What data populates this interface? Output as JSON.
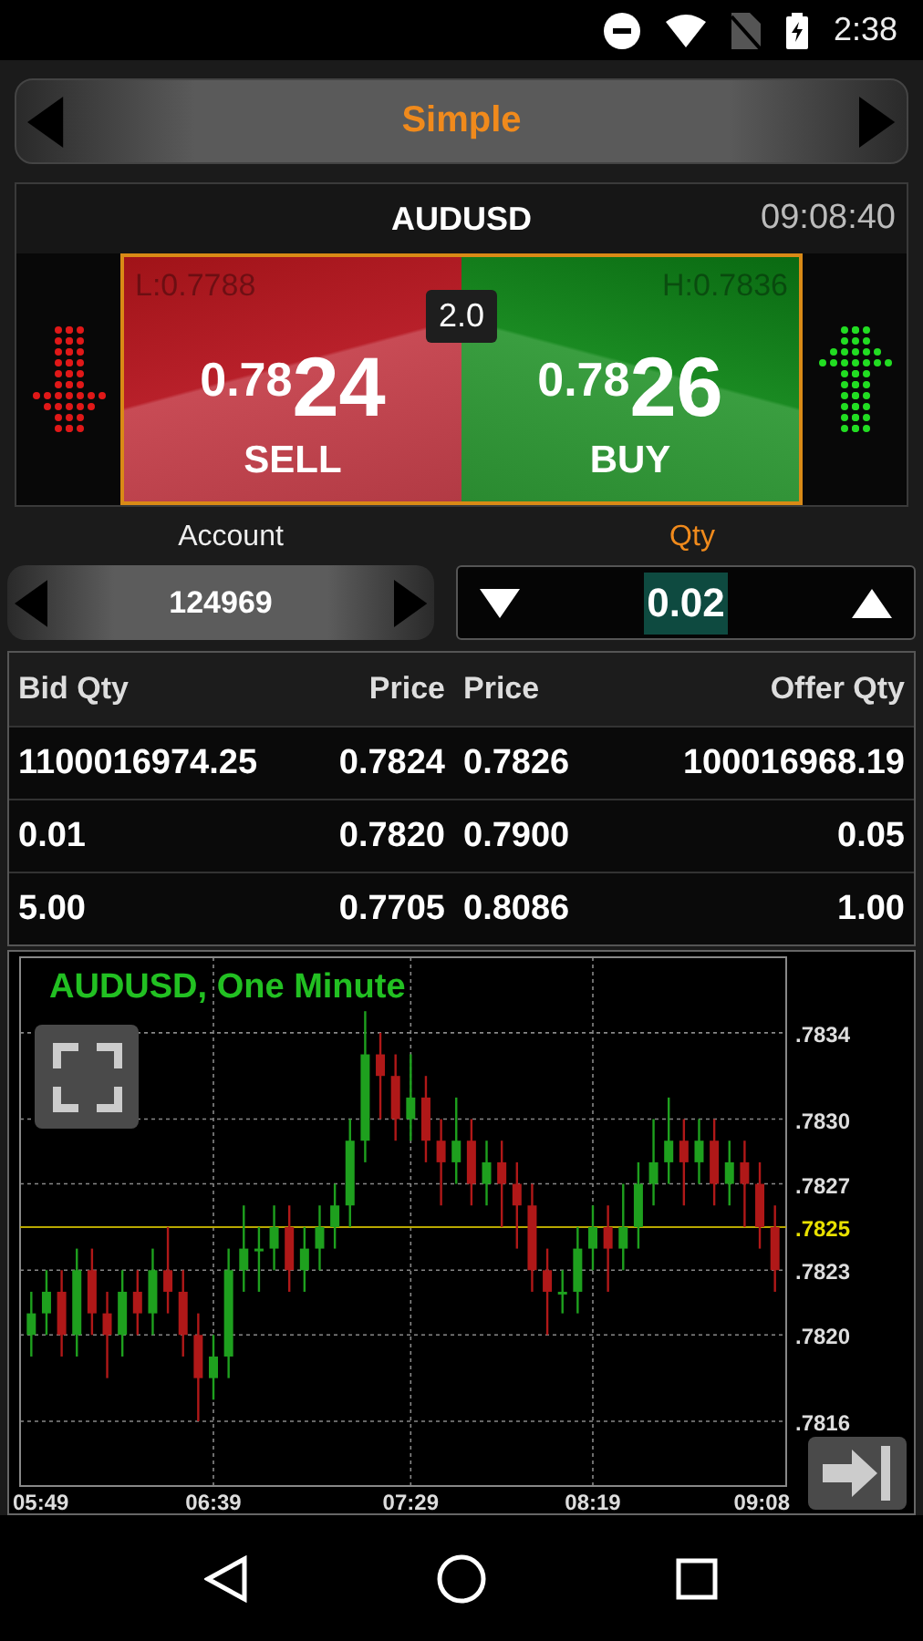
{
  "status_bar": {
    "time": "2:38"
  },
  "mode_selector": {
    "label": "Simple"
  },
  "quote": {
    "symbol": "AUDUSD",
    "time": "09:08:40",
    "low": "L:0.7788",
    "high": "H:0.7836",
    "spread": "2.0",
    "sell": {
      "price_prefix": "0.78",
      "price_big": "24",
      "label": "SELL"
    },
    "buy": {
      "price_prefix": "0.78",
      "price_big": "26",
      "label": "BUY"
    }
  },
  "account": {
    "label": "Account",
    "value": "124969"
  },
  "qty": {
    "label": "Qty",
    "value": "0.02"
  },
  "depth_table": {
    "columns": [
      "Bid Qty",
      "Price",
      "Price",
      "Offer Qty"
    ],
    "rows": [
      [
        "1100016974.25",
        "0.7824",
        "0.7826",
        "100016968.19"
      ],
      [
        "0.01",
        "0.7820",
        "0.7900",
        "0.05"
      ],
      [
        "5.00",
        "0.7705",
        "0.8086",
        "1.00"
      ]
    ]
  },
  "chart": {
    "chart_data": {
      "type": "candlestick",
      "title": "AUDUSD, One Minute",
      "categories": [
        "05:49",
        null,
        null,
        null,
        null,
        null,
        null,
        null,
        null,
        null,
        null,
        null,
        "06:39",
        null,
        null,
        null,
        null,
        null,
        null,
        null,
        null,
        null,
        null,
        null,
        null,
        "07:29",
        null,
        null,
        null,
        null,
        null,
        null,
        null,
        null,
        null,
        null,
        null,
        "08:19",
        null,
        null,
        null,
        null,
        null,
        null,
        null,
        null,
        null,
        null,
        null,
        "09:08"
      ],
      "ohlc": [
        [
          0.782,
          0.7822,
          0.7819,
          0.7821
        ],
        [
          0.7821,
          0.7823,
          0.782,
          0.7822
        ],
        [
          0.7822,
          0.7823,
          0.7819,
          0.782
        ],
        [
          0.782,
          0.7824,
          0.7819,
          0.7823
        ],
        [
          0.7823,
          0.7824,
          0.782,
          0.7821
        ],
        [
          0.7821,
          0.7822,
          0.7818,
          0.782
        ],
        [
          0.782,
          0.7823,
          0.7819,
          0.7822
        ],
        [
          0.7822,
          0.7823,
          0.782,
          0.7821
        ],
        [
          0.7821,
          0.7824,
          0.782,
          0.7823
        ],
        [
          0.7823,
          0.7825,
          0.7821,
          0.7822
        ],
        [
          0.7822,
          0.7823,
          0.7819,
          0.782
        ],
        [
          0.782,
          0.7821,
          0.7816,
          0.7818
        ],
        [
          0.7818,
          0.782,
          0.7817,
          0.7819
        ],
        [
          0.7819,
          0.7824,
          0.7818,
          0.7823
        ],
        [
          0.7823,
          0.7826,
          0.7822,
          0.7824
        ],
        [
          0.7824,
          0.7825,
          0.7822,
          0.7824
        ],
        [
          0.7824,
          0.7826,
          0.7823,
          0.7825
        ],
        [
          0.7825,
          0.7826,
          0.7822,
          0.7823
        ],
        [
          0.7823,
          0.7825,
          0.7822,
          0.7824
        ],
        [
          0.7824,
          0.7826,
          0.7823,
          0.7825
        ],
        [
          0.7825,
          0.7827,
          0.7824,
          0.7826
        ],
        [
          0.7826,
          0.783,
          0.7825,
          0.7829
        ],
        [
          0.7829,
          0.7835,
          0.7828,
          0.7833
        ],
        [
          0.7833,
          0.7834,
          0.783,
          0.7832
        ],
        [
          0.7832,
          0.7833,
          0.7829,
          0.783
        ],
        [
          0.783,
          0.7833,
          0.7829,
          0.7831
        ],
        [
          0.7831,
          0.7832,
          0.7828,
          0.7829
        ],
        [
          0.7829,
          0.783,
          0.7826,
          0.7828
        ],
        [
          0.7828,
          0.7831,
          0.7827,
          0.7829
        ],
        [
          0.7829,
          0.783,
          0.7826,
          0.7827
        ],
        [
          0.7827,
          0.7829,
          0.7826,
          0.7828
        ],
        [
          0.7828,
          0.7829,
          0.7825,
          0.7827
        ],
        [
          0.7827,
          0.7828,
          0.7824,
          0.7826
        ],
        [
          0.7826,
          0.7827,
          0.7822,
          0.7823
        ],
        [
          0.7823,
          0.7824,
          0.782,
          0.7822
        ],
        [
          0.7822,
          0.7823,
          0.7821,
          0.7822
        ],
        [
          0.7822,
          0.7825,
          0.7821,
          0.7824
        ],
        [
          0.7824,
          0.7826,
          0.7823,
          0.7825
        ],
        [
          0.7825,
          0.7826,
          0.7822,
          0.7824
        ],
        [
          0.7824,
          0.7827,
          0.7823,
          0.7825
        ],
        [
          0.7825,
          0.7828,
          0.7824,
          0.7827
        ],
        [
          0.7827,
          0.783,
          0.7826,
          0.7828
        ],
        [
          0.7828,
          0.7831,
          0.7827,
          0.7829
        ],
        [
          0.7829,
          0.783,
          0.7826,
          0.7828
        ],
        [
          0.7828,
          0.783,
          0.7827,
          0.7829
        ],
        [
          0.7829,
          0.783,
          0.7826,
          0.7827
        ],
        [
          0.7827,
          0.7829,
          0.7826,
          0.7828
        ],
        [
          0.7828,
          0.7829,
          0.7825,
          0.7827
        ],
        [
          0.7827,
          0.7828,
          0.7824,
          0.7825
        ],
        [
          0.7825,
          0.7826,
          0.7822,
          0.7823
        ]
      ],
      "ylim": [
        0.7813,
        0.78375
      ],
      "yticks": [
        {
          "value": 0.7834,
          "label": ".7834"
        },
        {
          "value": 0.783,
          "label": ".7830"
        },
        {
          "value": 0.7827,
          "label": ".7827"
        },
        {
          "value": 0.7823,
          "label": ".7823"
        },
        {
          "value": 0.782,
          "label": ".7820"
        },
        {
          "value": 0.7816,
          "label": ".7816"
        }
      ],
      "grid": true,
      "ref_lines": [
        {
          "axis": "y",
          "value": 0.7825,
          "label": ".7825"
        }
      ]
    }
  }
}
